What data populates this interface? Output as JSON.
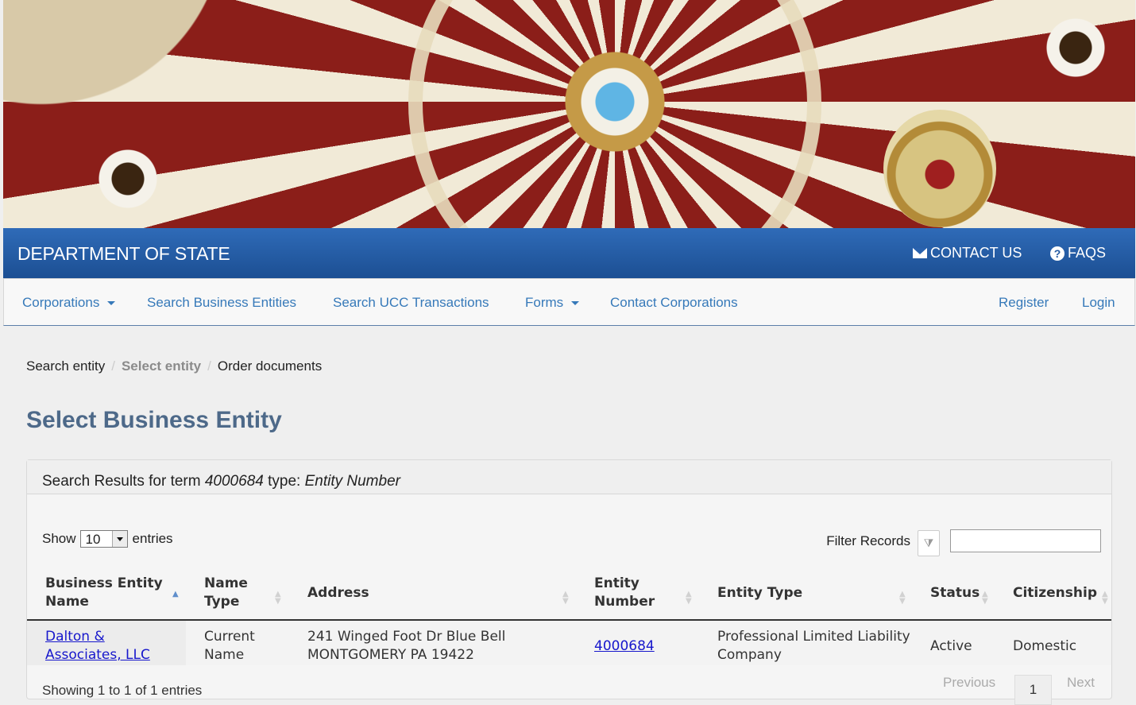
{
  "header": {
    "department": "DEPARTMENT OF STATE",
    "contact_label": "CONTACT US",
    "faqs_label": "FAQS",
    "icons": [
      "mail-icon",
      "question-circle-icon"
    ]
  },
  "nav": {
    "corporations": "Corporations",
    "search_business": "Search Business Entities",
    "search_ucc": "Search UCC Transactions",
    "forms": "Forms",
    "contact_corporations": "Contact Corporations",
    "register": "Register",
    "login": "Login"
  },
  "breadcrumb": {
    "step1": "Search entity",
    "step2": "Select entity",
    "step3": "Order documents",
    "separator": "/"
  },
  "page": {
    "title": "Select Business Entity"
  },
  "results": {
    "heading_prefix": "Search Results for term",
    "term": "4000684",
    "type_label": "type:",
    "type_value": "Entity Number",
    "show_label": "Show",
    "entries_value": "10",
    "entries_label": "entries",
    "filter_label": "Filter Records",
    "columns": [
      "Business Entity Name",
      "Name Type",
      "Address",
      "Entity Number",
      "Entity Type",
      "Status",
      "Citizenship"
    ],
    "rows": [
      {
        "business_entity_name": "Dalton & Associates, LLC",
        "name_type": "Current Name",
        "address_line1": "241 Winged Foot Dr Blue Bell",
        "address_line2": "MONTGOMERY PA 19422",
        "entity_number": "4000684",
        "entity_type": "Professional Limited Liability Company",
        "status": "Active",
        "citizenship": "Domestic"
      }
    ],
    "footer": {
      "showing": "Showing 1 to 1 of 1 entries",
      "previous": "Previous",
      "page": "1",
      "next": "Next"
    }
  },
  "colors": {
    "header_blue": "#245ca8",
    "link_blue": "#3679b9",
    "title_blue": "#4d6989"
  }
}
